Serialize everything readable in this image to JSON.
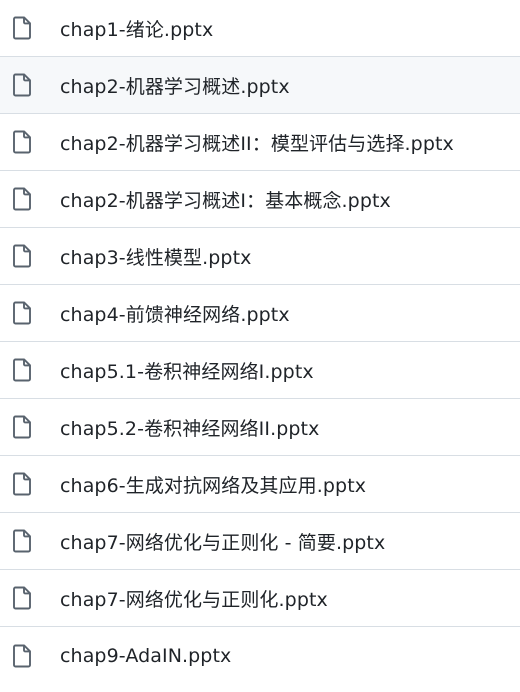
{
  "file_list": {
    "icon": "file-icon",
    "hovered_index": 1,
    "items": [
      {
        "name": "chap1-绪论.pptx"
      },
      {
        "name": "chap2-机器学习概述.pptx"
      },
      {
        "name": "chap2-机器学习概述II：模型评估与选择.pptx"
      },
      {
        "name": "chap2-机器学习概述I：基本概念.pptx"
      },
      {
        "name": "chap3-线性模型.pptx"
      },
      {
        "name": "chap4-前馈神经网络.pptx"
      },
      {
        "name": "chap5.1-卷积神经网络I.pptx"
      },
      {
        "name": "chap5.2-卷积神经网络II.pptx"
      },
      {
        "name": "chap6-生成对抗网络及其应用.pptx"
      },
      {
        "name": "chap7-网络优化与正则化 - 简要.pptx"
      },
      {
        "name": "chap7-网络优化与正则化.pptx"
      },
      {
        "name": "chap9-AdaIN.pptx"
      }
    ]
  },
  "colors": {
    "text": "#1f2328",
    "icon": "#59636e",
    "divider": "#d8dee4",
    "hover_bg": "#f6f8fa"
  }
}
